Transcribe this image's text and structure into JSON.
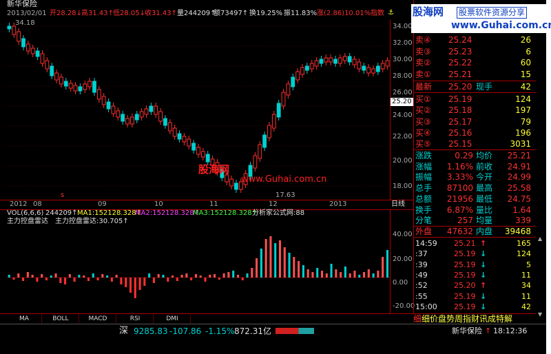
{
  "window": {
    "title": "新华保险"
  },
  "info": {
    "date": "2013/02/01",
    "open": "开28.28↓",
    "high": "高31.43↑",
    "low": "低28.05↓",
    "close": "收31.43↑",
    "volume": "量244209↑",
    "amount": "额73497↑",
    "turnover": "换19.25%",
    "swing": "振11.83%",
    "change": "涨(2.86)10.01%",
    "index_label": "指数"
  },
  "price_axis": [
    "34.00",
    "32.00",
    "30.00",
    "28.00",
    "26.00",
    "24.00",
    "22.00",
    "20.00",
    "18.00"
  ],
  "current_price_tag": "25.20",
  "annotations": {
    "high": "34.18",
    "low": "17.63",
    "low_marker": "s"
  },
  "watermark": {
    "brand": "股海网",
    "url": "www.Guhai.com.cn"
  },
  "date_axis": [
    "2012",
    "08",
    "09",
    "10",
    "11",
    "12",
    "2013",
    "日线"
  ],
  "volume_header": {
    "vol": "VOL(6,6,6)",
    "vol_val": "244209↑",
    "ma1": "MA1:152128.328↑",
    "ma2": "MA2:152128.328↑",
    "ma3": "MA3:152128.328↑",
    "formula": "分析家公式网:88",
    "indicator": "主力控盘雷达",
    "indicator_val": "主力控盘雷达:30.705↑"
  },
  "indicator_axis": [
    "40.00",
    "20.00",
    "0.00",
    "-20.00"
  ],
  "tabs": [
    "MA",
    "BOLL",
    "MACD",
    "RSI",
    "DMI"
  ],
  "order_book": {
    "sell": [
      {
        "label": "卖④",
        "price": "25.24",
        "vol": "26"
      },
      {
        "label": "卖③",
        "price": "25.23",
        "vol": "6"
      },
      {
        "label": "卖②",
        "price": "25.22",
        "vol": "60"
      },
      {
        "label": "卖①",
        "price": "25.21",
        "vol": "15"
      }
    ],
    "last": {
      "label": "最新",
      "price": "25.20",
      "hand_label": "现手",
      "hand": "42"
    },
    "buy": [
      {
        "label": "买①",
        "price": "25.19",
        "vol": "124"
      },
      {
        "label": "买②",
        "price": "25.18",
        "vol": "197"
      },
      {
        "label": "买③",
        "price": "25.17",
        "vol": "79"
      },
      {
        "label": "买④",
        "price": "25.16",
        "vol": "196"
      },
      {
        "label": "买⑤",
        "price": "25.15",
        "vol": "3031"
      }
    ]
  },
  "stats": [
    {
      "l1": "涨跌",
      "v1": "0.29",
      "l2": "均价",
      "v2": "25.21"
    },
    {
      "l1": "涨幅",
      "v1": "1.16%",
      "l2": "前收",
      "v2": "24.91"
    },
    {
      "l1": "振幅",
      "v1": "3.33%",
      "l2": "今开",
      "v2": "24.99"
    },
    {
      "l1": "总手",
      "v1": "87100",
      "l2": "最高",
      "v2": "25.58"
    },
    {
      "l1": "总额",
      "v1": "21956",
      "l2": "最低",
      "v2": "24.75"
    },
    {
      "l1": "换手",
      "v1": "6.87%",
      "l2": "量比",
      "v2": "1.64"
    },
    {
      "l1": "分笔",
      "v1": "257",
      "l2": "均量",
      "v2": "339"
    }
  ],
  "outer_inner": {
    "out_label": "外盘",
    "out": "47632",
    "in_label": "内盘",
    "in": "39468"
  },
  "ticks": [
    {
      "time": "14:59",
      "price": "25.21",
      "dir": "↑",
      "vol": "165"
    },
    {
      "time": ":37",
      "price": "25.19",
      "dir": "↓",
      "vol": "124"
    },
    {
      "time": ":39",
      "price": "25.19",
      "dir": "↓",
      "vol": "5"
    },
    {
      "time": ":49",
      "price": "25.19",
      "dir": "↓",
      "vol": "11"
    },
    {
      "time": ":52",
      "price": "25.20",
      "dir": "↑",
      "vol": "34"
    },
    {
      "time": ":55",
      "price": "25.19",
      "dir": "↓",
      "vol": "11"
    },
    {
      "time": "15:00",
      "price": "25.19",
      "dir": "↓",
      "vol": "42"
    }
  ],
  "panel_tabs": "细价盘势周指财讯成特解",
  "brand_box": {
    "name": "股海网",
    "slogan": "股票软件资源分享",
    "url": "www.Guhai.com.cn"
  },
  "statusbar": {
    "market": "深",
    "index": "9285.83",
    "change": "-107.86",
    "pct": "-1.15%",
    "amount": "872.31亿",
    "stock": "新华保险",
    "time": "18:12:36"
  }
}
